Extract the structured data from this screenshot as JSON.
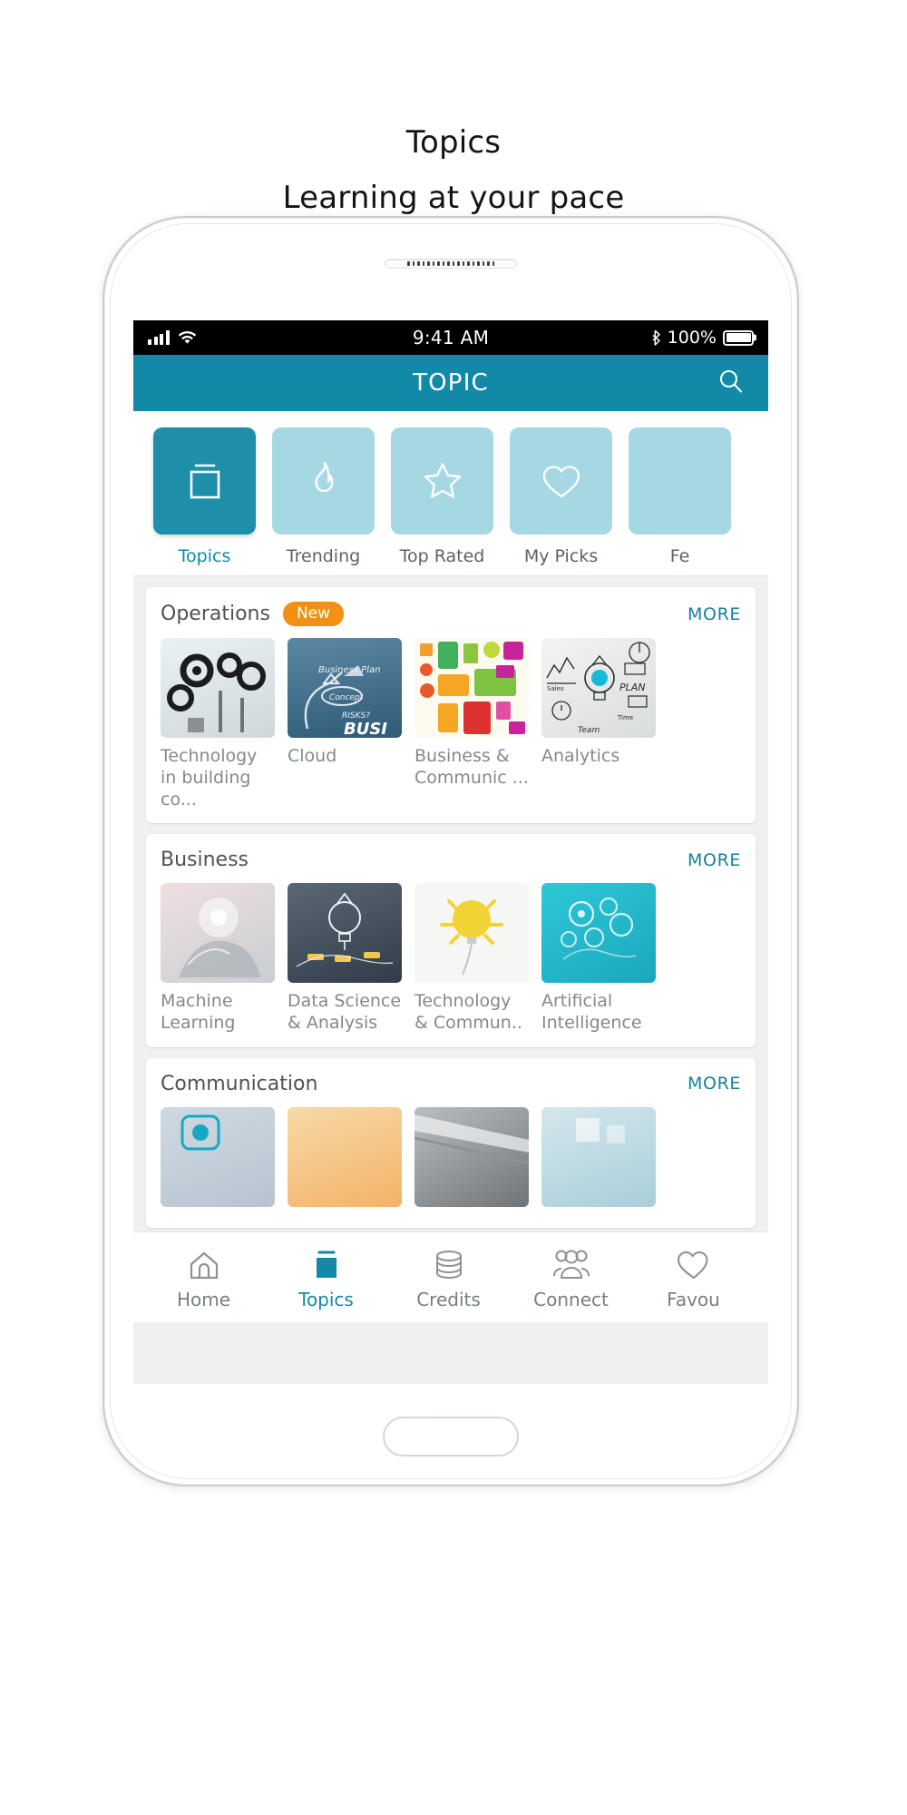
{
  "page": {
    "title": "Topics",
    "subtitle": "Learning at your pace"
  },
  "colors": {
    "accent": "#1289A7",
    "accent_dark": "#1E8FA8",
    "tab_inactive": "#A6D8E3",
    "badge_orange": "#F29111",
    "more_link": "#15819B",
    "caption_grey": "#83898C"
  },
  "statusbar": {
    "signal_icon": "signal-bars-icon",
    "wifi_icon": "wifi-icon",
    "time": "9:41 AM",
    "bluetooth_icon": "bluetooth-icon",
    "battery_percent": "100%",
    "battery_icon": "battery-full-icon"
  },
  "appbar": {
    "title": "TOPIC",
    "search_icon": "search-icon"
  },
  "tabs": [
    {
      "label": "Topics",
      "icon": "box-icon",
      "active": true
    },
    {
      "label": "Trending",
      "icon": "flame-icon",
      "active": false
    },
    {
      "label": "Top Rated",
      "icon": "star-icon",
      "active": false
    },
    {
      "label": "My Picks",
      "icon": "heart-icon",
      "active": false
    },
    {
      "label": "Fe",
      "icon": "partial-icon",
      "active": false
    }
  ],
  "sections": [
    {
      "title": "Operations",
      "badge": "New",
      "more": "MORE",
      "items": [
        {
          "caption": "Technology in building co...",
          "art": "gear-art"
        },
        {
          "caption": "Cloud",
          "art": "plan-art"
        },
        {
          "caption": "Business & Communic ...",
          "art": "icons-art"
        },
        {
          "caption": "Analytics",
          "art": "sketch-art"
        }
      ]
    },
    {
      "title": "Business",
      "badge": "",
      "more": "MORE",
      "items": [
        {
          "caption": "Machine Learning",
          "art": "hand-art"
        },
        {
          "caption": "Data Science & Analysis",
          "art": "chalk-art"
        },
        {
          "caption": "Technology & Commun..",
          "art": "bulb-art"
        },
        {
          "caption": "Artificial Intelligence",
          "art": "brain-art"
        }
      ]
    },
    {
      "title": "Communication",
      "badge": "",
      "more": "MORE",
      "items": [
        {
          "caption": "",
          "art": "c1-art"
        },
        {
          "caption": "",
          "art": "c2-art"
        },
        {
          "caption": "",
          "art": "c3-art"
        },
        {
          "caption": "",
          "art": "c4-art"
        }
      ]
    }
  ],
  "bottomnav": [
    {
      "label": "Home",
      "icon": "home-icon",
      "active": false
    },
    {
      "label": "Topics",
      "icon": "box-filled-icon",
      "active": true
    },
    {
      "label": "Credits",
      "icon": "coins-icon",
      "active": false
    },
    {
      "label": "Connect",
      "icon": "people-icon",
      "active": false
    },
    {
      "label": "Favou",
      "icon": "heart-icon",
      "active": false
    }
  ]
}
